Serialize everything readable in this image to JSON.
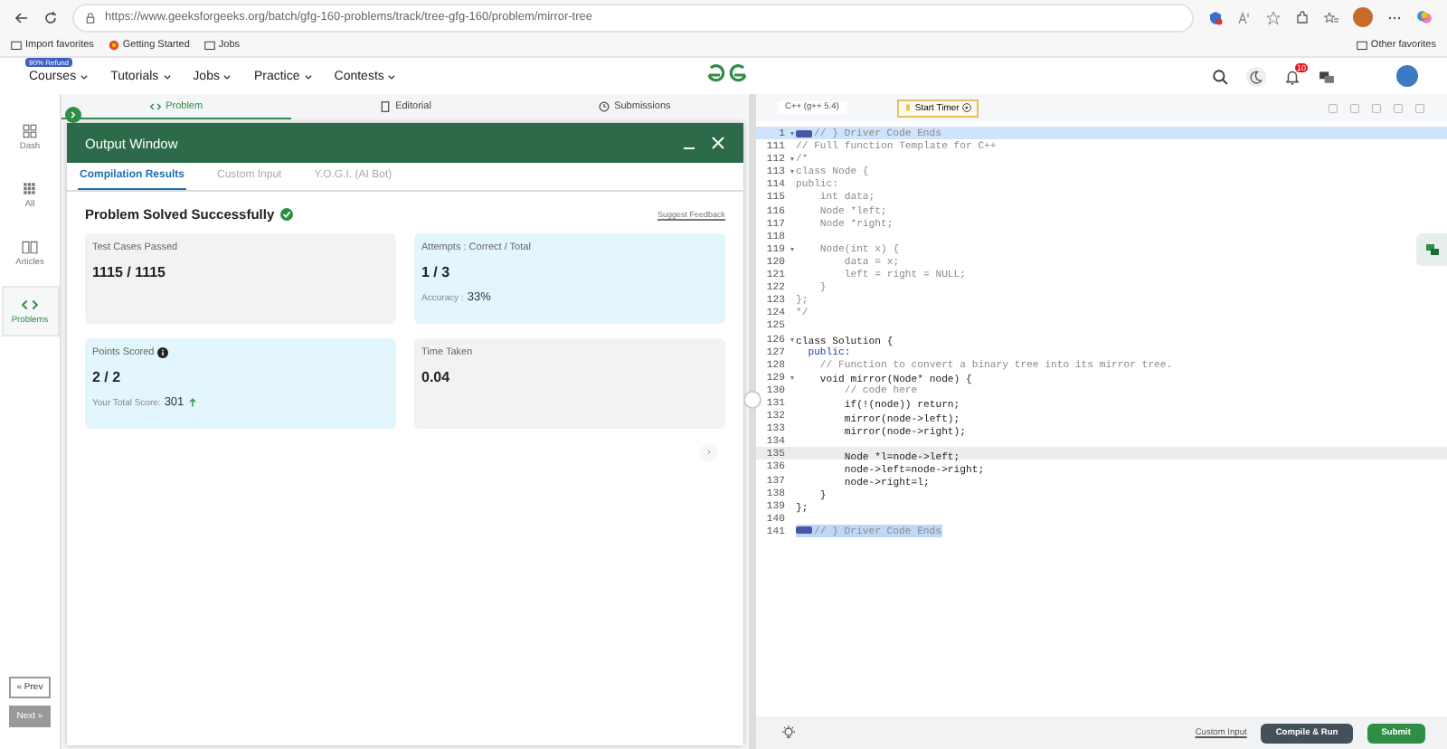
{
  "browser": {
    "url": "https://www.geeksforgeeks.org/batch/gfg-160-problems/track/tree-gfg-160/problem/mirror-tree",
    "favorites": [
      "Import favorites",
      "Getting Started",
      "Jobs"
    ],
    "other_favorites": "Other favorites"
  },
  "site_header": {
    "badge": "90% Refund",
    "nav": [
      "Courses",
      "Tutorials",
      "Jobs",
      "Practice",
      "Contests"
    ],
    "notification_count": "10"
  },
  "sidebar": {
    "items": [
      {
        "label": "Dash",
        "kind": "dash",
        "selected": false
      },
      {
        "label": "All",
        "kind": "all",
        "selected": false
      },
      {
        "label": "Articles",
        "kind": "articles",
        "selected": false
      },
      {
        "label": "Problems",
        "kind": "problems",
        "selected": true
      }
    ],
    "prev": "« Prev",
    "next": "Next »"
  },
  "problem_tabs": [
    {
      "label": "Problem",
      "kind": "code",
      "selected": true
    },
    {
      "label": "Editorial",
      "kind": "doc",
      "selected": false
    },
    {
      "label": "Submissions",
      "kind": "clock",
      "selected": false
    }
  ],
  "output_window": {
    "title": "Output Window",
    "tabs": [
      {
        "label": "Compilation Results",
        "selected": true
      },
      {
        "label": "Custom Input",
        "selected": false
      },
      {
        "label": "Y.O.G.I. (AI Bot)",
        "selected": false
      }
    ],
    "status": "Problem Solved Successfully",
    "feedback": "Suggest Feedback",
    "cards": [
      {
        "label": "Test Cases Passed",
        "value": "1115 / 1115",
        "highlighted": false,
        "info": false
      },
      {
        "label": "Attempts : Correct / Total",
        "value": "1 / 3",
        "highlighted": true,
        "info": false,
        "note_label": "Accuracy :",
        "note_value": "33%"
      },
      {
        "label": "Points Scored",
        "value": "2 / 2",
        "highlighted": true,
        "info": true,
        "note_label": "Your Total Score:",
        "note_value": "301"
      },
      {
        "label": "Time Taken",
        "value": "0.04",
        "highlighted": false,
        "info": false
      }
    ]
  },
  "editor": {
    "language": "C++ (g++ 5.4)",
    "timer": "Start Timer",
    "lines": [
      {
        "n": "1",
        "text": "// } Driver Code Ends",
        "kind": "comment",
        "fold": true,
        "tag": true,
        "selected": true,
        "current": false
      },
      {
        "n": "111",
        "text": "// Full function Template for C++",
        "kind": "comment",
        "fold": false,
        "tag": false,
        "selected": false,
        "current": false
      },
      {
        "n": "112",
        "text": "/*",
        "kind": "comment",
        "fold": true,
        "tag": false,
        "selected": false,
        "current": false
      },
      {
        "n": "113",
        "text": "class Node {",
        "kind": "comment",
        "fold": true,
        "tag": false,
        "selected": false,
        "current": false
      },
      {
        "n": "114",
        "text": "public:",
        "kind": "comment",
        "fold": false,
        "tag": false,
        "selected": false,
        "current": false
      },
      {
        "n": "115",
        "text": "    int data;",
        "kind": "comment",
        "fold": false,
        "tag": false,
        "selected": false,
        "current": false
      },
      {
        "n": "116",
        "text": "    Node *left;",
        "kind": "comment",
        "fold": false,
        "tag": false,
        "selected": false,
        "current": false
      },
      {
        "n": "117",
        "text": "    Node *right;",
        "kind": "comment",
        "fold": false,
        "tag": false,
        "selected": false,
        "current": false
      },
      {
        "n": "118",
        "kind": "comment",
        "fold": false,
        "tag": false,
        "selected": false,
        "current": false
      },
      {
        "n": "119",
        "text": "    Node(int x) {",
        "kind": "comment",
        "fold": true,
        "tag": false,
        "selected": false,
        "current": false
      },
      {
        "n": "120",
        "text": "        data = x;",
        "kind": "comment",
        "fold": false,
        "tag": false,
        "selected": false,
        "current": false
      },
      {
        "n": "121",
        "text": "        left = right = NULL;",
        "kind": "comment",
        "fold": false,
        "tag": false,
        "selected": false,
        "current": false
      },
      {
        "n": "122",
        "text": "    }",
        "kind": "comment",
        "fold": false,
        "tag": false,
        "selected": false,
        "current": false
      },
      {
        "n": "123",
        "text": "};",
        "kind": "comment",
        "fold": false,
        "tag": false,
        "selected": false,
        "current": false
      },
      {
        "n": "124",
        "text": "*/",
        "kind": "comment",
        "fold": false,
        "tag": false,
        "selected": false,
        "current": false
      },
      {
        "n": "125",
        "kind": "code",
        "fold": false,
        "tag": false,
        "selected": false,
        "current": false
      },
      {
        "n": "126",
        "text": "class Solution {",
        "kind": "code",
        "fold": true,
        "tag": false,
        "selected": false,
        "current": false
      },
      {
        "n": "127",
        "text": "  public:",
        "kind": "keyword",
        "fold": false,
        "tag": false,
        "selected": false,
        "current": false
      },
      {
        "n": "128",
        "text": "    // Function to convert a binary tree into its mirror tree.",
        "kind": "comment",
        "fold": false,
        "tag": false,
        "selected": false,
        "current": false
      },
      {
        "n": "129",
        "text": "    void mirror(Node* node) {",
        "kind": "code",
        "fold": true,
        "tag": false,
        "selected": false,
        "current": false
      },
      {
        "n": "130",
        "text": "        // code here",
        "kind": "comment",
        "fold": false,
        "tag": false,
        "selected": false,
        "current": false
      },
      {
        "n": "131",
        "text": "        if(!(node)) return;",
        "kind": "code",
        "fold": false,
        "tag": false,
        "selected": false,
        "current": false
      },
      {
        "n": "132",
        "text": "        mirror(node->left);",
        "kind": "code",
        "fold": false,
        "tag": false,
        "selected": false,
        "current": false
      },
      {
        "n": "133",
        "text": "        mirror(node->right);",
        "kind": "code",
        "fold": false,
        "tag": false,
        "selected": false,
        "current": false
      },
      {
        "n": "134",
        "kind": "code",
        "fold": false,
        "tag": false,
        "selected": false,
        "current": false
      },
      {
        "n": "135",
        "text": "        Node *l=node->left;",
        "kind": "code",
        "fold": false,
        "tag": false,
        "selected": false,
        "current": true
      },
      {
        "n": "136",
        "text": "        node->left=node->right;",
        "kind": "code",
        "fold": false,
        "tag": false,
        "selected": false,
        "current": false
      },
      {
        "n": "137",
        "text": "        node->right=l;",
        "kind": "code",
        "fold": false,
        "tag": false,
        "selected": false,
        "current": false
      },
      {
        "n": "138",
        "text": "    }",
        "kind": "code",
        "fold": false,
        "tag": false,
        "selected": false,
        "current": false
      },
      {
        "n": "139",
        "text": "};",
        "kind": "code",
        "fold": false,
        "tag": false,
        "selected": false,
        "current": false
      },
      {
        "n": "140",
        "kind": "code",
        "fold": false,
        "tag": false,
        "selected": false,
        "current": false
      },
      {
        "n": "141",
        "text": "// } Driver Code Ends",
        "kind": "comment",
        "fold": false,
        "tag": true,
        "selected": true,
        "current": false
      }
    ],
    "custom_input": "Custom Input",
    "compile": "Compile & Run",
    "submit": "Submit"
  }
}
